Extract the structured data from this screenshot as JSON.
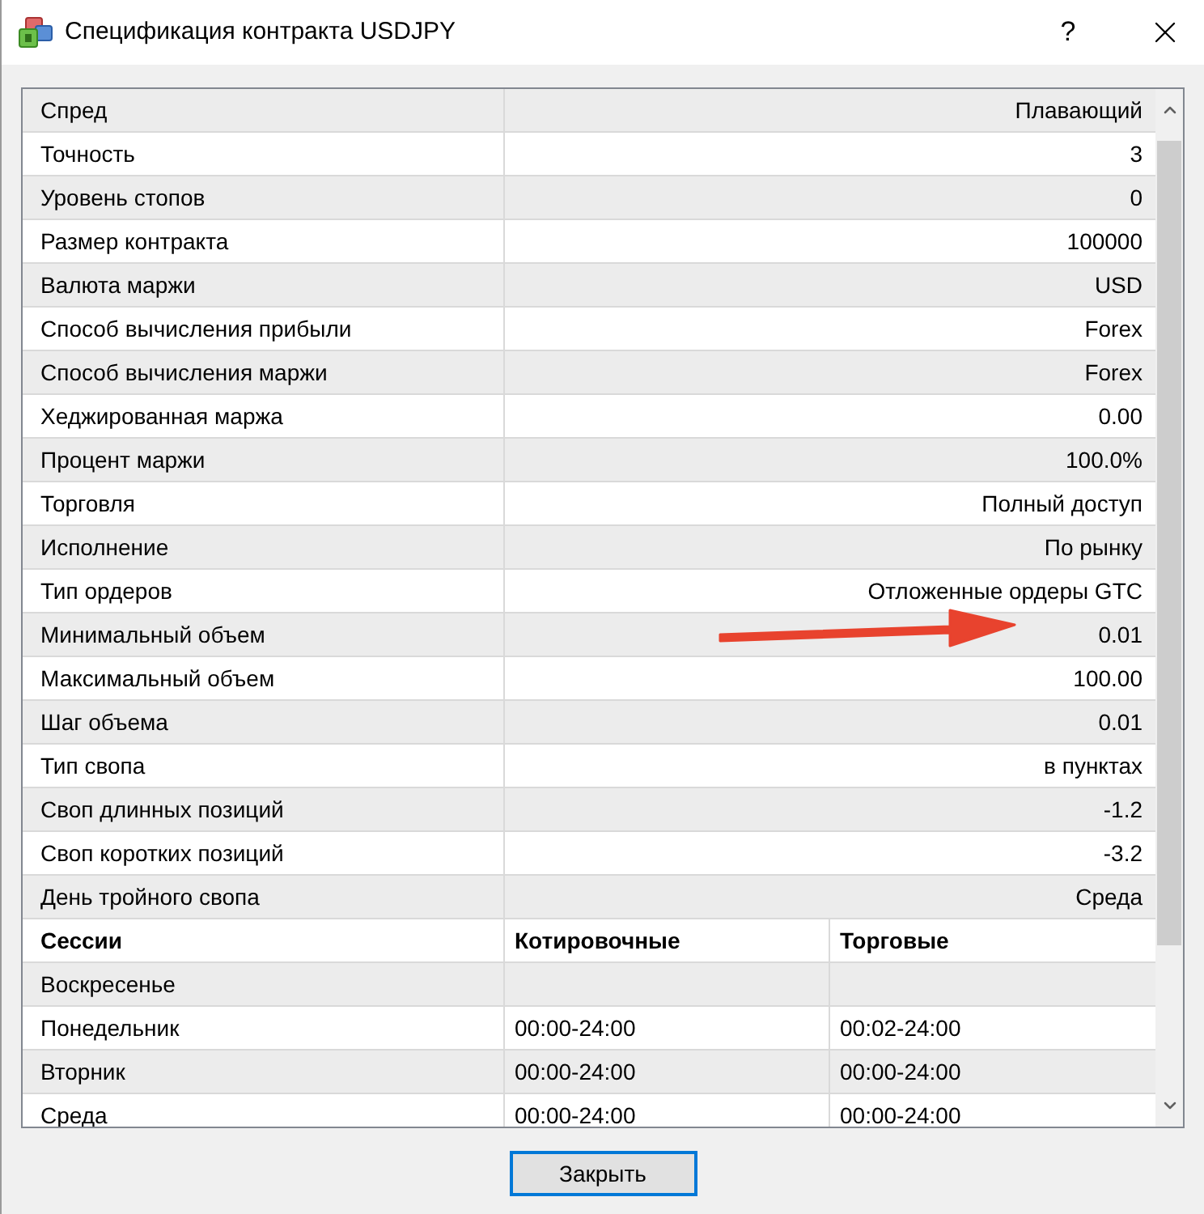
{
  "window": {
    "title": "Спецификация контракта USDJPY",
    "help_button": "?"
  },
  "specs": [
    {
      "name": "Спред",
      "value": "Плавающий",
      "marked": false
    },
    {
      "name": "Точность",
      "value": "3",
      "marked": false
    },
    {
      "name": "Уровень стопов",
      "value": "0",
      "marked": false
    },
    {
      "name": "Размер контракта",
      "value": "100000",
      "marked": false
    },
    {
      "name": "Валюта маржи",
      "value": "USD",
      "marked": false
    },
    {
      "name": "Способ вычисления прибыли",
      "value": "Forex",
      "marked": false
    },
    {
      "name": "Способ вычисления маржи",
      "value": "Forex",
      "marked": false
    },
    {
      "name": "Хеджированная маржа",
      "value": "0.00",
      "marked": false
    },
    {
      "name": "Процент маржи",
      "value": "100.0%",
      "marked": false
    },
    {
      "name": "Торговля",
      "value": "Полный доступ",
      "marked": false
    },
    {
      "name": "Исполнение",
      "value": "По рынку",
      "marked": false
    },
    {
      "name": "Тип ордеров",
      "value": "Отложенные ордеры GTC",
      "marked": false
    },
    {
      "name": "Минимальный объем",
      "value": "0.01",
      "marked": true
    },
    {
      "name": "Максимальный объем",
      "value": "100.00",
      "marked": false
    },
    {
      "name": "Шаг объема",
      "value": "0.01",
      "marked": false
    },
    {
      "name": "Тип свопа",
      "value": "в пунктах",
      "marked": false
    },
    {
      "name": "Своп длинных позиций",
      "value": "-1.2",
      "marked": false
    },
    {
      "name": "Своп коротких позиций",
      "value": "-3.2",
      "marked": false
    },
    {
      "name": "День тройного свопа",
      "value": "Среда",
      "marked": false
    }
  ],
  "sessions": {
    "columns": [
      "Сессии",
      "Котировочные",
      "Торговые"
    ],
    "rows": [
      {
        "day": "Воскресенье"
      },
      {
        "day": "Понедельник",
        "quotes": "00:00-24:00",
        "trading": "00:02-24:00"
      },
      {
        "day": "Вторник",
        "quotes": "00:00-24:00",
        "trading": "00:00-24:00"
      },
      {
        "day": "Среда",
        "quotes": "00:00-24:00",
        "trading": "00:00-24:00"
      }
    ]
  },
  "close_button": {
    "label": "Закрыть",
    "focused": true
  }
}
